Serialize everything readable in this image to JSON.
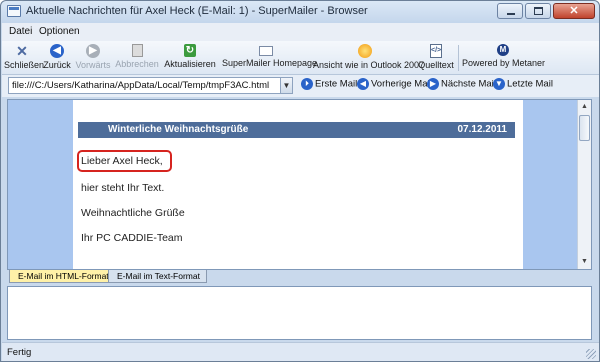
{
  "window": {
    "title": "Aktuelle Nachrichten für Axel Heck (E-Mail: 1) - SuperMailer - Browser"
  },
  "menu": {
    "items": [
      "Datei",
      "Optionen"
    ]
  },
  "toolbar": {
    "close_label": "Schließen",
    "back_label": "Zurück",
    "forward_label": "Vorwärts",
    "stop_label": "Abbrechen",
    "refresh_label": "Aktualisieren",
    "homepage_label": "SuperMailer Homepage",
    "outlook_label": "Ansicht wie in Outlook 2007",
    "source_label": "Quelltext",
    "powered_label": "Powered by Metaner"
  },
  "addressbar": {
    "url": "file:///C:/Users/Katharina/AppData/Local/Temp/tmpF3AC.html",
    "first_mail": "Erste Mail",
    "prev_mail": "Vorherige Mail",
    "next_mail": "Nächste Mail",
    "last_mail": "Letzte Mail"
  },
  "mail": {
    "header_title": "Winterliche Weihnachtsgrüße",
    "header_date": "07.12.2011",
    "salutation": "Lieber Axel Heck,",
    "body_line": "hier steht Ihr Text.",
    "greeting": "Weihnachtliche Grüße",
    "signature": "Ihr PC CADDIE-Team"
  },
  "tabs": {
    "html_format": "E-Mail im HTML-Format",
    "text_format": "E-Mail im Text-Format"
  },
  "status": {
    "text": "Fertig"
  },
  "colors": {
    "mail_header_bg": "#4e6d9a",
    "highlight_border": "#d6241f",
    "viewport_bg": "#a9c6ef",
    "active_tab_bg": "#fff1a8"
  }
}
